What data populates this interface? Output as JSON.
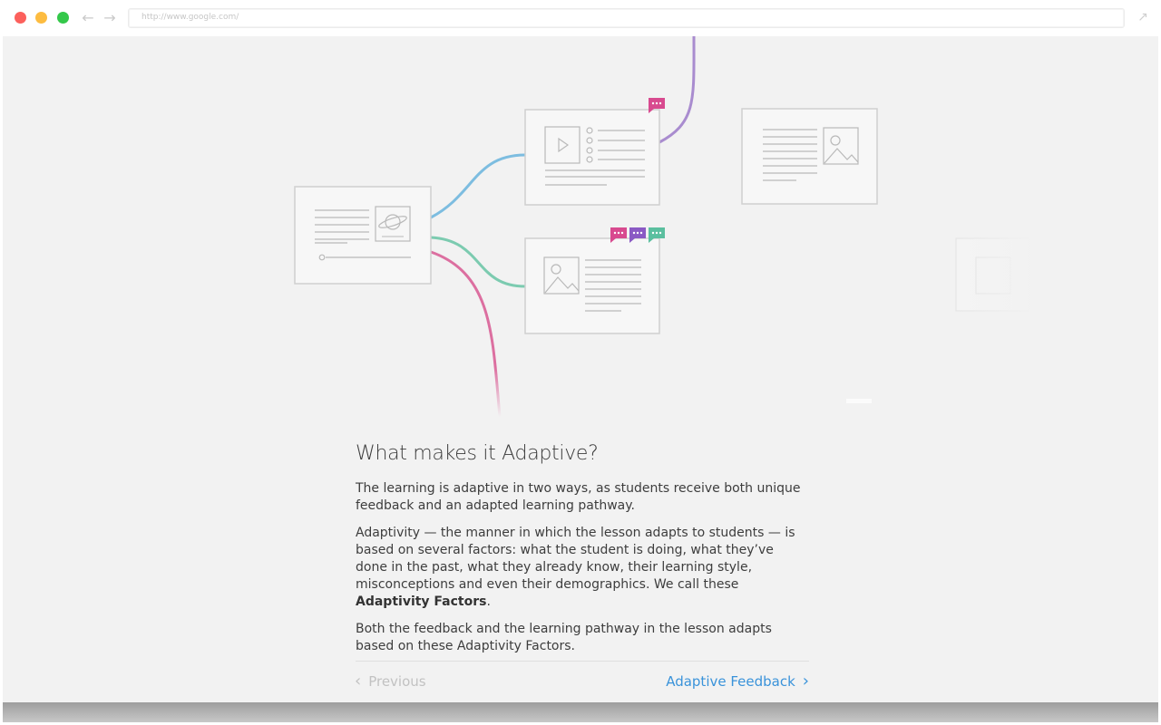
{
  "browser": {
    "url": "http://www.google.com/",
    "back_icon": "arrow-left-icon",
    "forward_icon": "arrow-right-icon",
    "expand_icon": "expand-icon"
  },
  "colors": {
    "blue_path": "#7dbde0",
    "green_path": "#7ccbb0",
    "pink_path": "#dc6fa0",
    "purple_path": "#a98ccf",
    "link": "#3a93da",
    "badge_pink": "#d84a8f",
    "badge_purple": "#8a5ac4",
    "badge_teal": "#5bbf9f"
  },
  "content": {
    "title": "What makes it Adaptive?",
    "p1": "The learning is adaptive in two ways, as students receive both unique feedback and an adapted learning pathway.",
    "p2_before": "Adaptivity — the manner in which the lesson adapts to students — is based on several factors: what the student is doing, what they’ve done in the past, what they already know, their learning style, misconceptions and even their demographics. We call these ",
    "p2_bold": "Adaptivity Factors",
    "p2_after": ".",
    "p3": "Both the feedback and the learning pathway in the lesson adapts based on these Adaptivity Factors."
  },
  "nav": {
    "prev_label": "Previous",
    "next_label": "Adaptive Feedback"
  }
}
